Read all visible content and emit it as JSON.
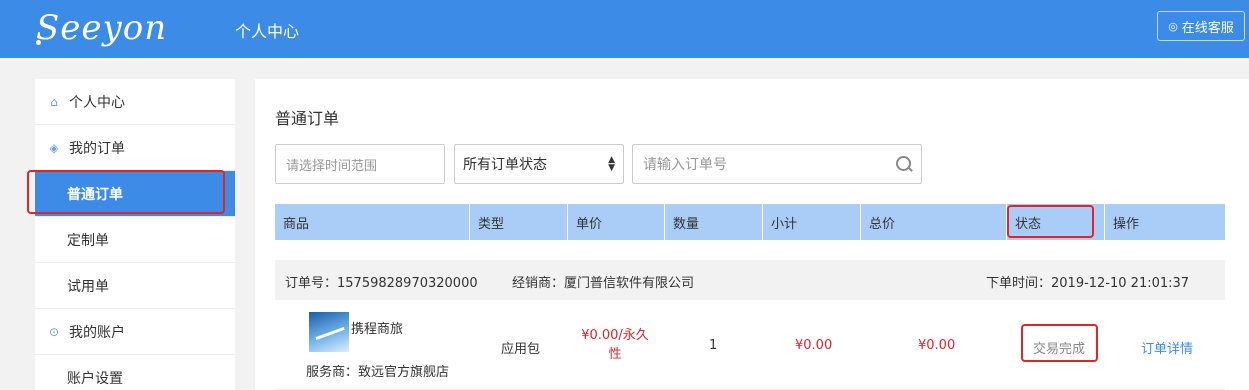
{
  "header": {
    "logo_text": "Seeyon",
    "title": "个人中心",
    "service_label": "在线客服",
    "service_icon": "headset-icon",
    "bg_color": "#3c8ce7"
  },
  "sidebar": {
    "items": [
      {
        "label": "个人中心",
        "icon": "home-icon"
      },
      {
        "label": "我的订单",
        "icon": "layers-icon"
      },
      {
        "label": "普通订单"
      },
      {
        "label": "定制单"
      },
      {
        "label": "试用单"
      },
      {
        "label": "我的账户",
        "icon": "account-icon"
      },
      {
        "label": "账户设置"
      }
    ],
    "active": "普通订单"
  },
  "main": {
    "title": "普通订单",
    "filters": {
      "date_placeholder": "请选择时间范围",
      "status_selected": "所有订单状态",
      "search_placeholder": "请输入订单号"
    },
    "columns": [
      "商品",
      "类型",
      "单价",
      "数量",
      "小计",
      "总价",
      "状态",
      "操作"
    ],
    "order": {
      "order_no": "订单号：15759828970320000",
      "dealer": "经销商：厦门普信软件有限公司",
      "time": "下单时间：2019-12-10 21:01:37",
      "product_name": "携程商旅",
      "seller": "服务商：致远官方旗舰店",
      "type": "应用包",
      "price_line1": "¥0.00/永久",
      "price_line2": "性",
      "quantity": "1",
      "subtotal": "¥0.00",
      "total": "¥0.00",
      "status": "交易完成",
      "action": "订单详情"
    }
  },
  "colors": {
    "accent": "#3c8ce7",
    "table_header": "#a9cdf6",
    "price": "#e5212a",
    "highlight": "#e5212a"
  }
}
